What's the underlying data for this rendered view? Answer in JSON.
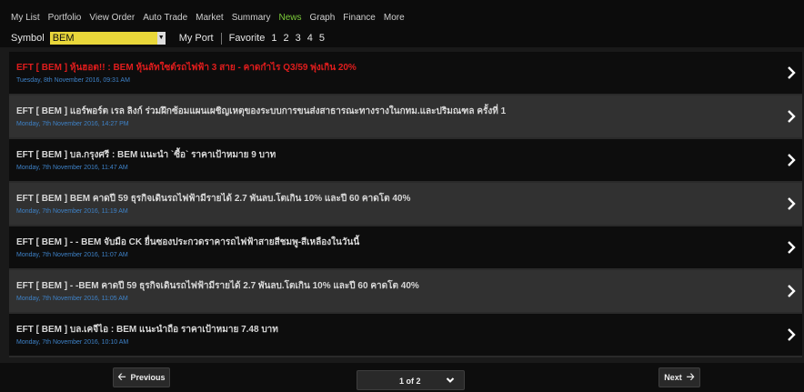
{
  "nav": {
    "items": [
      "My List",
      "Portfolio",
      "View Order",
      "Auto Trade",
      "Market",
      "Summary",
      "News",
      "Graph",
      "Finance",
      "More"
    ],
    "active": "News",
    "active_color": "#7ccc3a"
  },
  "symbol_bar": {
    "label": "Symbol",
    "value": "BEM",
    "my_port": "My Port",
    "favorite_label": "Favorite",
    "favorites": [
      "1",
      "2",
      "3",
      "4",
      "5"
    ]
  },
  "news": [
    {
      "title": "EFT [ BEM ] หุ้นฮอต!! : BEM หุ้นลัทใซต์รถไฟฟ้า 3 สาย - คาดกำไร Q3/59 พุ่งเกิน 20%",
      "date": "Tuesday, 8th November 2016, 09:31 AM",
      "highlight": true
    },
    {
      "title": "EFT [ BEM ] แอร์พอร์ต เรล ลิงก์ ร่วมฝึกซ้อมแผนเผชิญเหตุของระบบการขนส่งสาธารณะทางรางในกทม.และปริมณฑล ครั้งที่ 1",
      "date": "Monday, 7th November 2016, 14:27 PM",
      "highlight": false
    },
    {
      "title": "EFT [ BEM ] บล.กรุงศรี : BEM แนะนำ `ซื้อ` ราคาเป้าหมาย 9 บาท",
      "date": "Monday, 7th November 2016, 11:47 AM",
      "highlight": false
    },
    {
      "title": "EFT [ BEM ] BEM คาดปี 59 ธุรกิจเดินรถไฟฟ้ามีรายได้ 2.7 พันลบ.โตเกิน 10% และปี 60 คาดโต 40%",
      "date": "Monday, 7th November 2016, 11:19 AM",
      "highlight": false
    },
    {
      "title": "EFT [ BEM ] - - BEM จับมือ CK ยื่นซองประกวดราคารถไฟฟ้าสายสีชมพู-สีเหลืองในวันนี้",
      "date": "Monday, 7th November 2016, 11:07 AM",
      "highlight": false
    },
    {
      "title": "EFT [ BEM ] - -BEM คาดปี 59 ธุรกิจเดินรถไฟฟ้ามีรายได้ 2.7 พันลบ.โตเกิน 10% และปี 60 คาดโต 40%",
      "date": "Monday, 7th November 2016, 11:05 AM",
      "highlight": false
    },
    {
      "title": "EFT [ BEM ] บล.เคจีไอ : BEM แนะนำถือ ราคาเป้าหมาย 7.48 บาท",
      "date": "Monday, 7th November 2016, 10:10 AM",
      "highlight": false
    }
  ],
  "pager": {
    "prev_label": "Previous",
    "next_label": "Next",
    "page_text": "1 of 2"
  },
  "colors": {
    "highlight_title": "#e01d1d",
    "date_text": "#3e82c8",
    "symbol_box": "#e9d73a"
  }
}
